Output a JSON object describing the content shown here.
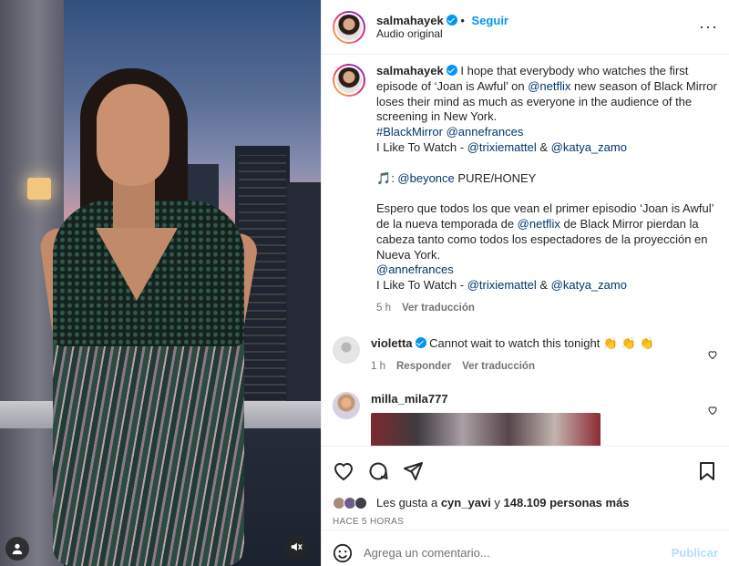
{
  "post": {
    "username": "salmahayek",
    "follow_label": "Seguir",
    "audio": "Audio original",
    "more": "···"
  },
  "caption": {
    "lines_en_1": "I hope that everybody who watches the first episode of ‘Joan is Awful’ on ",
    "netflix": "@netflix",
    "lines_en_2": " new season of Black Mirror loses their mind as much as everyone in the audience of the screening in New York.",
    "hashtag": "#BlackMirror",
    "annefrances": "@annefrances",
    "like_to_watch": "I Like To Watch - ",
    "trixie": "@trixiemattel",
    "amp": " & ",
    "katya": "@katya_zamo",
    "music_note": "🎵",
    "beyonce": "@beyonce",
    "song": " PURE/HONEY",
    "es_1": "Espero que todos los que vean el primer episodio ‘Joan is Awful’ de la nueva temporada de ",
    "es_2": " de Black Mirror pierdan la cabeza tanto como todos los espectadores de la proyección en Nueva York.",
    "time": "5 h",
    "translate": "Ver traducción"
  },
  "comments": [
    {
      "username": "violetta",
      "text": "Cannot wait to watch this tonight 👏 👏 👏",
      "time": "1 h",
      "reply": "Responder",
      "translate": "Ver traducción"
    },
    {
      "username": "milla_mila777"
    }
  ],
  "likes": {
    "prefix": "Les gusta a ",
    "user": "cyn_yavi",
    "and": " y ",
    "count": "148.109 personas más"
  },
  "posted": "HACE 5 HORAS",
  "comment_input": {
    "placeholder": "Agrega un comentario...",
    "publish": "Publicar"
  },
  "colors": {
    "accent": "#0095f6",
    "link": "#00376b",
    "muted": "#737373",
    "publish_disabled": "#b2dffc"
  },
  "icons": [
    "user-tag-icon",
    "mute-icon",
    "heart-icon",
    "comment-icon",
    "share-icon",
    "bookmark-icon",
    "emoji-icon",
    "verified-icon",
    "more-icon"
  ]
}
